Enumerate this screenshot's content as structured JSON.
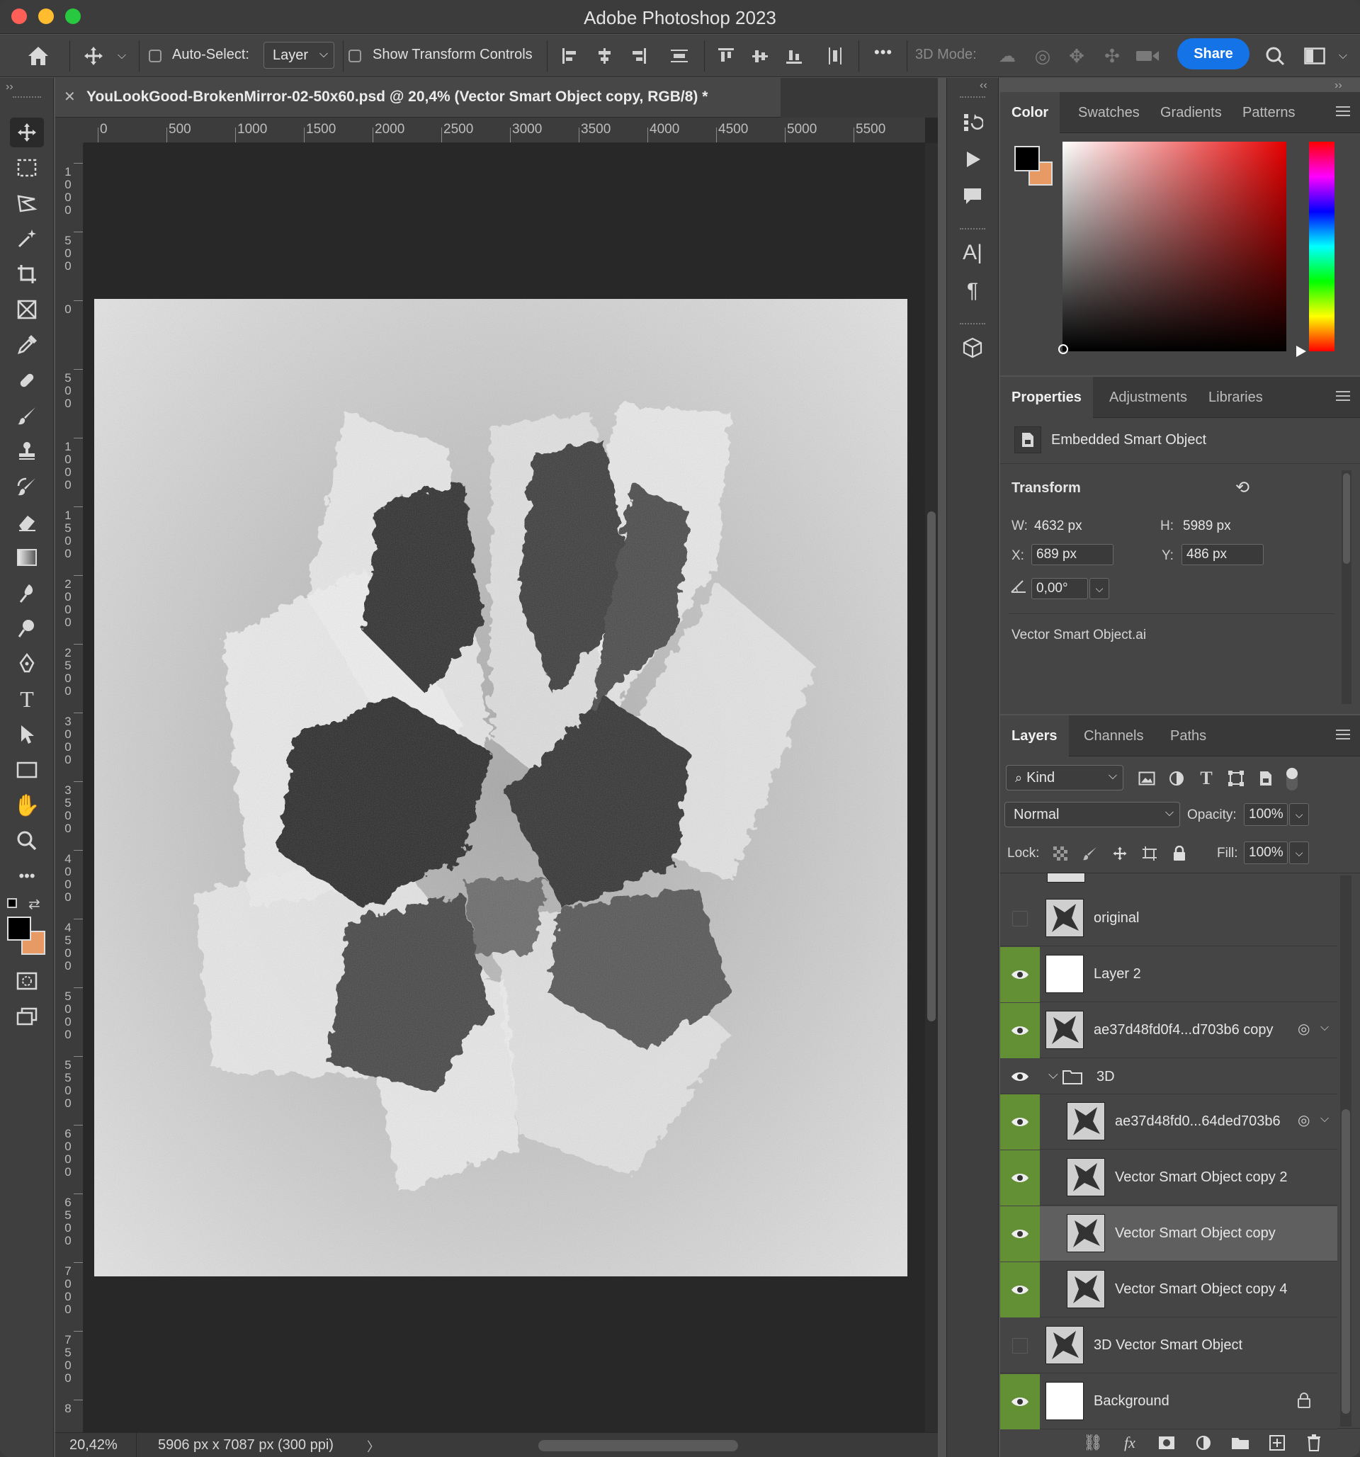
{
  "window": {
    "title": "Adobe Photoshop 2023"
  },
  "options": {
    "auto_select_label": "Auto-Select:",
    "auto_select_value": "Layer",
    "show_transform_label": "Show Transform Controls",
    "mode_3d_label": "3D Mode:",
    "share_label": "Share",
    "more": "•••"
  },
  "document": {
    "tab_title": "YouLookGood-BrokenMirror-02-50x60.psd @ 20,4% (Vector Smart Object copy, RGB/8) *",
    "close": "✕",
    "zoom": "20,42%",
    "dimensions": "5906 px x 7087 px (300 ppi)",
    "status_arrow": "〉"
  },
  "ruler_h": [
    "0",
    "500",
    "1000",
    "1500",
    "2000",
    "2500",
    "3000",
    "3500",
    "4000",
    "4500",
    "5000",
    "5500"
  ],
  "ruler_v": [
    "1000",
    "500",
    "0",
    "500",
    "1000",
    "1500",
    "2000",
    "2500",
    "3000",
    "3500",
    "4000",
    "4500",
    "5000",
    "5500",
    "6000",
    "6500",
    "7000",
    "7500",
    "8"
  ],
  "colors": {
    "foreground": "#000000",
    "background": "#e79a63",
    "accent": "#1473e6",
    "layer_visible": "#638f35"
  },
  "color_panel": {
    "tabs": [
      "Color",
      "Swatches",
      "Gradients",
      "Patterns"
    ]
  },
  "properties_panel": {
    "tabs": [
      "Properties",
      "Adjustments",
      "Libraries"
    ],
    "object_type": "Embedded Smart Object",
    "transform_heading": "Transform",
    "w_label": "W:",
    "w_value": "4632 px",
    "h_label": "H:",
    "h_value": "5989 px",
    "x_label": "X:",
    "x_value": "689 px",
    "y_label": "Y:",
    "y_value": "486 px",
    "angle_value": "0,00°",
    "linked_file": "Vector Smart Object.ai"
  },
  "layers_panel": {
    "tabs": [
      "Layers",
      "Channels",
      "Paths"
    ],
    "filter_kind": "Kind",
    "blend_mode": "Normal",
    "opacity_label": "Opacity:",
    "opacity_value": "100%",
    "lock_label": "Lock:",
    "fill_label": "Fill:",
    "fill_value": "100%",
    "layers": [
      {
        "name": "original",
        "visible": false,
        "indent": 0
      },
      {
        "name": "Layer 2",
        "visible": true,
        "indent": 0
      },
      {
        "name": "ae37d48fd0f4...d703b6 copy",
        "visible": true,
        "indent": 0
      },
      {
        "name": "3D",
        "visible": true,
        "indent": 0,
        "group": true
      },
      {
        "name": "ae37d48fd0...64ded703b6",
        "visible": true,
        "indent": 1
      },
      {
        "name": "Vector Smart Object copy 2",
        "visible": true,
        "indent": 1
      },
      {
        "name": "Vector Smart Object copy",
        "visible": true,
        "indent": 1,
        "selected": true
      },
      {
        "name": "Vector Smart Object copy 4",
        "visible": true,
        "indent": 1
      },
      {
        "name": "3D Vector Smart Object",
        "visible": false,
        "indent": 0
      },
      {
        "name": "Background",
        "visible": true,
        "indent": 0,
        "locked": true
      }
    ]
  }
}
